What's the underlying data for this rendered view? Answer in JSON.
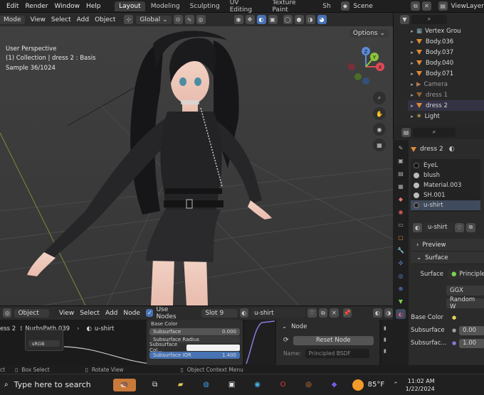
{
  "menubar": {
    "items": [
      "Edit",
      "Render",
      "Window",
      "Help"
    ],
    "workspace_tabs": [
      "Layout",
      "Modeling",
      "Sculpting",
      "UV Editing",
      "Texture Paint",
      "Sh"
    ],
    "active_tab": "Layout",
    "scene": "Scene",
    "view_layer": "ViewLayer"
  },
  "viewport_header": {
    "mode": "Mode",
    "menus": [
      "View",
      "Select",
      "Add",
      "Object"
    ],
    "orientation": "Global",
    "options": "Options"
  },
  "viewport": {
    "perspective": "User Perspective",
    "collection_info": "(1) Collection | dress 2 : Basis",
    "sample": "Sample 36/1024",
    "gizmo": {
      "x": "X",
      "y": "Y",
      "z": "Z"
    }
  },
  "outliner": {
    "items": [
      {
        "label": "Vertex Grou",
        "kind": "group"
      },
      {
        "label": "Body.036",
        "kind": "mesh"
      },
      {
        "label": "Body.037",
        "kind": "mesh"
      },
      {
        "label": "Body.040",
        "kind": "mesh"
      },
      {
        "label": "Body.071",
        "kind": "mesh"
      },
      {
        "label": "Camera",
        "kind": "camera"
      },
      {
        "label": "dress 1",
        "kind": "mesh"
      },
      {
        "label": "dress 2",
        "kind": "mesh"
      },
      {
        "label": "Light",
        "kind": "light"
      }
    ]
  },
  "properties": {
    "object_name": "dress 2",
    "materials": [
      "EyeL",
      "blush",
      "Material.003",
      "SH.001",
      "u-shirt"
    ],
    "active_material": "u-shirt",
    "material_field": "u-shirt",
    "panels": {
      "preview": "Preview",
      "surface": "Surface"
    },
    "surface_label": "Surface",
    "surface_value": "Principle",
    "distribution": "GGX",
    "subsurface_method": "Random W",
    "base_color_label": "Base Color",
    "subsurface_label": "Subsurface",
    "subsurface_value": "0.00",
    "subsurface_r_label": "Subsurfac...",
    "subsurface_r_value": "1.00"
  },
  "node_editor": {
    "editor": "Object",
    "menus": [
      "View",
      "Select",
      "Add",
      "Node"
    ],
    "use_nodes": "Use Nodes",
    "slot": "Slot 9",
    "material": "u-shirt",
    "breadcrumb_left": "ess 2",
    "breadcrumb_mid": "NurbsPath.039",
    "breadcrumb_right": "u-shirt",
    "image_node": {
      "colorspace": "sRGB"
    },
    "bsdf_rows": [
      {
        "label": "Base Color",
        "value": ""
      },
      {
        "label": "Subsurface",
        "value": "0.000"
      },
      {
        "label": "Subsurface Radius",
        "value": ""
      },
      {
        "label": "Subsurface Col...",
        "value": ""
      },
      {
        "label": "Subsurface IOR",
        "value": "1.400"
      }
    ],
    "side_panel": {
      "title": "Node",
      "reset": "Reset Node",
      "name_label": "Name:",
      "name_value": "Principled BSDF"
    }
  },
  "statusbar": {
    "left": "ct",
    "box_select": "Box Select",
    "rotate": "Rotate View",
    "context_menu": "Object Context Menu"
  },
  "taskbar": {
    "search_placeholder": "Type here to search",
    "weather": "85°F",
    "time": "11:02 AM",
    "date": "1/22/2024"
  },
  "colors": {
    "accent": "#4772b3",
    "viewport_bg": "#3c3c3c",
    "mesh_orange": "#e08b3a"
  }
}
